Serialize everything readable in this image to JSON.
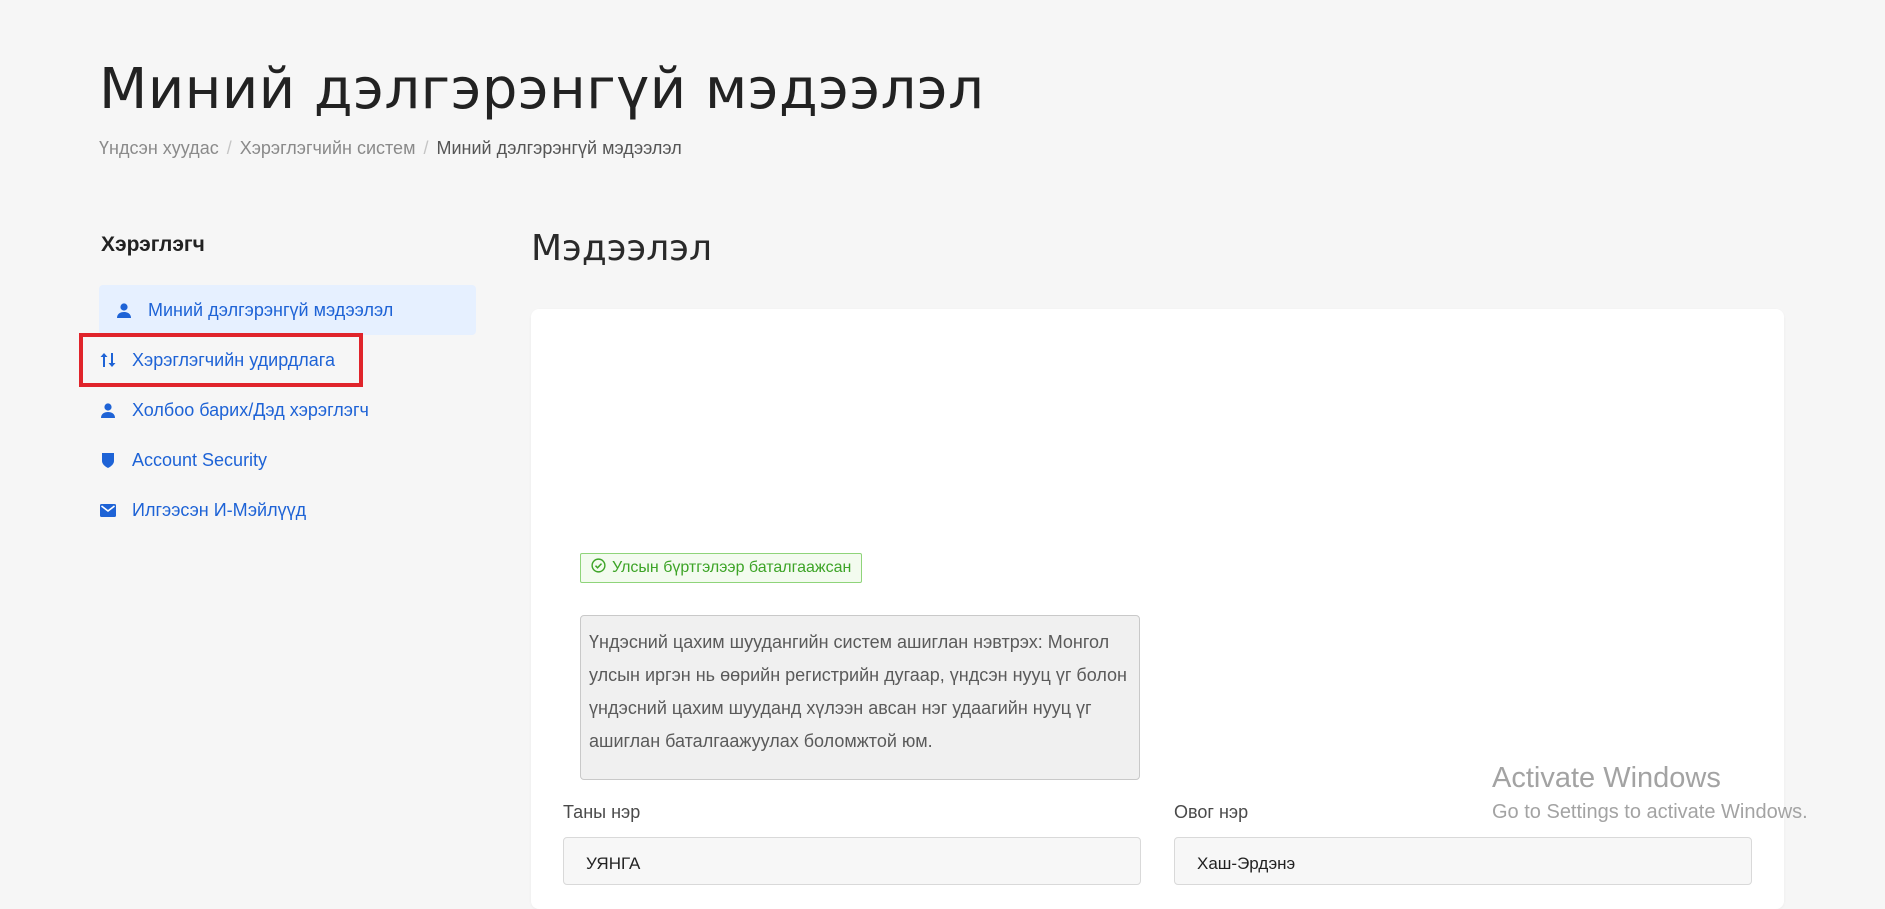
{
  "page": {
    "title": "Миний дэлгэрэнгүй мэдээлэл",
    "breadcrumb": [
      "Үндсэн хуудас",
      "Хэрэглэгчийн систем",
      "Миний дэлгэрэнгүй мэдээлэл"
    ],
    "breadcrumb_sep": "/"
  },
  "sidebar": {
    "title": "Хэрэглэгч",
    "items": [
      {
        "label": "Миний дэлгэрэнгүй мэдээлэл",
        "icon": "user-icon"
      },
      {
        "label": "Хэрэглэгчийн удирдлага",
        "icon": "sort-arrows-icon"
      },
      {
        "label": "Холбоо барих/Дэд хэрэглэгч",
        "icon": "user-icon"
      },
      {
        "label": "Account Security",
        "icon": "shield-icon"
      },
      {
        "label": "Илгээсэн И-Мэйлүүд",
        "icon": "mail-icon"
      }
    ]
  },
  "main": {
    "section_title": "Мэдээлэл",
    "verified_badge": "Улсын бүртгэлээр баталгаажсан",
    "info_text": "Үндэсний цахим шуудангийн систем ашиглан нэвтрэх: Монгол улсын иргэн нь өөрийн регистрийн дугаар, үндсэн нууц үг болон үндэсний цахим шууданд хүлээн авсан нэг удаагийн нууц үг ашиглан баталгаажуулах боломжтой юм.",
    "first_name_label": "Таны нэр",
    "first_name_value": "УЯНГА",
    "last_name_label": "Овог нэр",
    "last_name_value": "Хаш-Эрдэнэ"
  },
  "watermark": {
    "line1": "Activate Windows",
    "line2": "Go to Settings to activate Windows."
  },
  "colors": {
    "accent": "#1e63d6",
    "active_bg": "#e6f0ff",
    "highlight": "#e0242b",
    "verified": "#3da427"
  }
}
